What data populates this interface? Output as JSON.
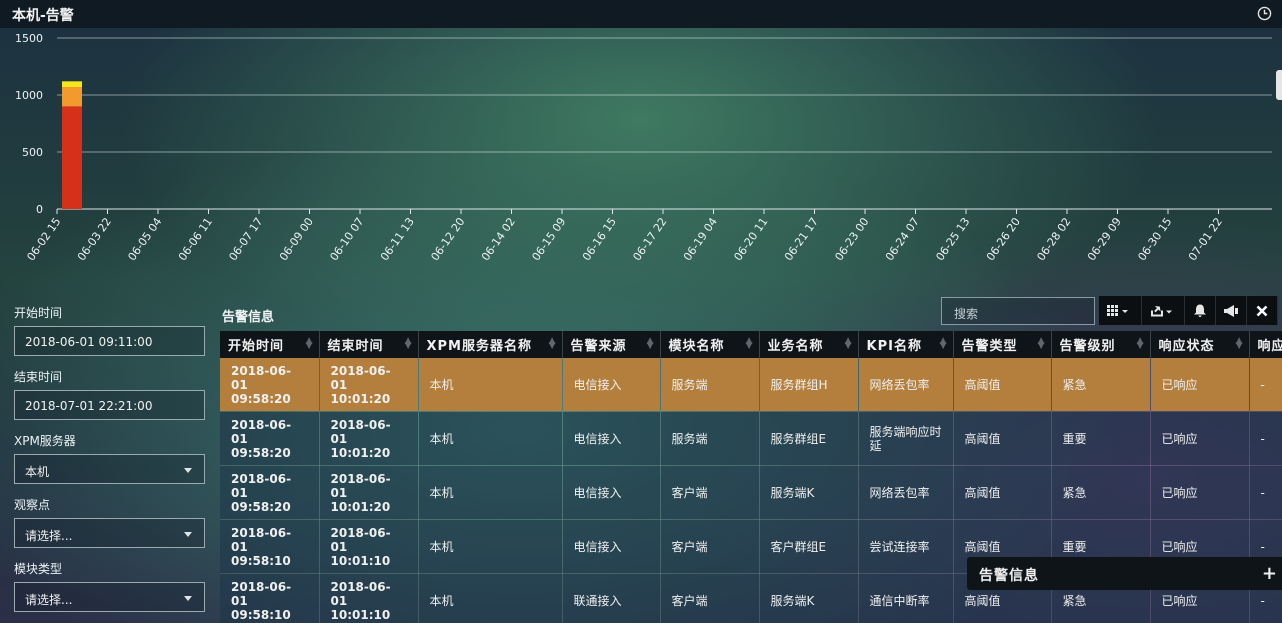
{
  "header": {
    "title": "本机-告警",
    "clock_icon": "clock-icon"
  },
  "chart_data": {
    "type": "bar",
    "stacked": true,
    "categories": [
      "06-02 15",
      "06-03 22",
      "06-05 04",
      "06-06 11",
      "06-07 17",
      "06-09 00",
      "06-10 07",
      "06-11 13",
      "06-12 20",
      "06-14 02",
      "06-15 09",
      "06-16 15",
      "06-17 22",
      "06-19 04",
      "06-20 11",
      "06-21 17",
      "06-23 00",
      "06-24 07",
      "06-25 13",
      "06-26 20",
      "06-28 02",
      "06-29 09",
      "06-30 15",
      "07-01 22"
    ],
    "series": [
      {
        "values": [
          900,
          0,
          0,
          0,
          0,
          0,
          0,
          0,
          0,
          0,
          0,
          0,
          0,
          0,
          0,
          0,
          0,
          0,
          0,
          0,
          0,
          0,
          0,
          0
        ],
        "color": "#d6301a"
      },
      {
        "values": [
          170,
          0,
          0,
          0,
          0,
          0,
          0,
          0,
          0,
          0,
          0,
          0,
          0,
          0,
          0,
          0,
          0,
          0,
          0,
          0,
          0,
          0,
          0,
          0
        ],
        "color": "#f39a2e"
      },
      {
        "values": [
          50,
          0,
          0,
          0,
          0,
          0,
          0,
          0,
          0,
          0,
          0,
          0,
          0,
          0,
          0,
          0,
          0,
          0,
          0,
          0,
          0,
          0,
          0,
          0
        ],
        "color": "#f5e61c"
      }
    ],
    "yticks": [
      0,
      500,
      1000,
      1500
    ],
    "ylim": [
      0,
      1500
    ],
    "grid": true
  },
  "filters": {
    "start_label": "开始时间",
    "start_value": "2018-06-01 09:11:00",
    "end_label": "结束时间",
    "end_value": "2018-07-01 22:21:00",
    "server_label": "XPM服务器",
    "server_value": "本机",
    "point_label": "观察点",
    "point_value": "请选择...",
    "module_label": "模块类型",
    "module_value": "请选择..."
  },
  "alarms": {
    "title": "告警信息",
    "search_placeholder": "搜索",
    "toolbar_icons": [
      "grid-icon",
      "export-icon",
      "bell-icon",
      "megaphone-icon",
      "close-icon"
    ],
    "columns": [
      "开始时间",
      "结束时间",
      "XPM服务器名称",
      "告警来源",
      "模块名称",
      "业务名称",
      "KPI名称",
      "告警类型",
      "告警级别",
      "响应状态",
      "响应"
    ],
    "rows": [
      [
        "2018-06-01 09:58:20",
        "2018-06-01 10:01:20",
        "本机",
        "电信接入",
        "服务端",
        "服务群组H",
        "网络丢包率",
        "高阈值",
        "紧急",
        "已响应",
        "-"
      ],
      [
        "2018-06-01 09:58:20",
        "2018-06-01 10:01:20",
        "本机",
        "电信接入",
        "服务端",
        "服务群组E",
        "服务端响应时延",
        "高阈值",
        "重要",
        "已响应",
        "-"
      ],
      [
        "2018-06-01 09:58:20",
        "2018-06-01 10:01:20",
        "本机",
        "电信接入",
        "客户端",
        "服务端K",
        "网络丢包率",
        "高阈值",
        "紧急",
        "已响应",
        "-"
      ],
      [
        "2018-06-01 09:58:10",
        "2018-06-01 10:01:10",
        "本机",
        "电信接入",
        "客户端",
        "客户群组E",
        "尝试连接率",
        "高阈值",
        "重要",
        "已响应",
        "-"
      ],
      [
        "2018-06-01 09:58:10",
        "2018-06-01 10:01:10",
        "本机",
        "联通接入",
        "客户端",
        "服务端K",
        "通信中断率",
        "高阈值",
        "紧急",
        "已响应",
        "-"
      ]
    ]
  },
  "floating_panel": {
    "title": "告警信息",
    "plus": "+"
  }
}
